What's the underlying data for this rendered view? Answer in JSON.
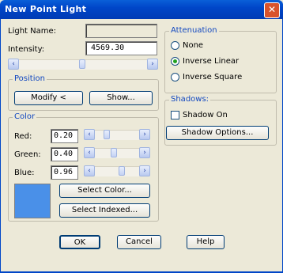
{
  "window": {
    "title": "New Point Light",
    "close_glyph": "✕"
  },
  "light_name": {
    "label": "Light Name:",
    "value": ""
  },
  "intensity": {
    "label": "Intensity:",
    "value": "4569.30"
  },
  "position": {
    "title": "Position",
    "modify_label": "Modify <",
    "show_label": "Show..."
  },
  "color": {
    "title": "Color",
    "red": {
      "label": "Red:",
      "value": "0.20"
    },
    "green": {
      "label": "Green:",
      "value": "0.40"
    },
    "blue": {
      "label": "Blue:",
      "value": "0.96"
    },
    "swatch": "#4a90e8",
    "select_color_label": "Select Color...",
    "select_indexed_label": "Select Indexed..."
  },
  "attenuation": {
    "title": "Attenuation",
    "options": [
      "None",
      "Inverse Linear",
      "Inverse Square"
    ],
    "selected": "Inverse Linear"
  },
  "shadows": {
    "title": "Shadows:",
    "shadow_on_label": "Shadow On",
    "shadow_on_checked": false,
    "options_label": "Shadow Options..."
  },
  "footer": {
    "ok_label": "OK",
    "cancel_label": "Cancel",
    "help_label": "Help"
  },
  "icons": {
    "left_arrow": "‹",
    "right_arrow": "›"
  },
  "colors": {
    "title_bar": "#0046c8",
    "group_title": "#1248c0",
    "selected_radio": "#21a121"
  }
}
